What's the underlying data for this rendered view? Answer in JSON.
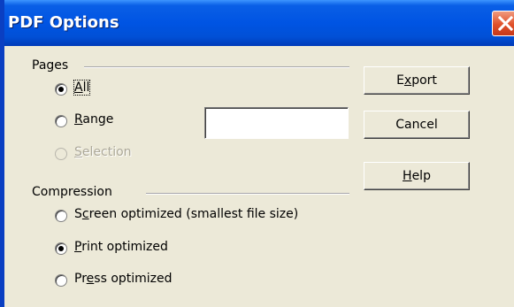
{
  "window": {
    "title": "PDF Options"
  },
  "pages": {
    "group_label": "Pages",
    "options": [
      {
        "pre": "",
        "key": "A",
        "post": "ll",
        "checked": true,
        "disabled": false
      },
      {
        "pre": "",
        "key": "R",
        "post": "ange",
        "checked": false,
        "disabled": false
      },
      {
        "pre": "",
        "key": "S",
        "post": "election",
        "checked": false,
        "disabled": true
      }
    ],
    "range_value": ""
  },
  "compression": {
    "group_label": "Compression",
    "options": [
      {
        "pre": "S",
        "key": "c",
        "post": "reen optimized (smallest file size)",
        "checked": false
      },
      {
        "pre": "",
        "key": "P",
        "post": "rint optimized",
        "checked": true
      },
      {
        "pre": "Pr",
        "key": "e",
        "post": "ss optimized",
        "checked": false
      }
    ]
  },
  "buttons": {
    "export": {
      "pre": "E",
      "key": "x",
      "post": "port"
    },
    "cancel": {
      "label": "Cancel"
    },
    "help": {
      "pre": "",
      "key": "H",
      "post": "elp"
    }
  },
  "icons": {
    "close": "close-icon",
    "radio_checked": "radio-checked",
    "radio_unchecked": "radio-unchecked"
  }
}
